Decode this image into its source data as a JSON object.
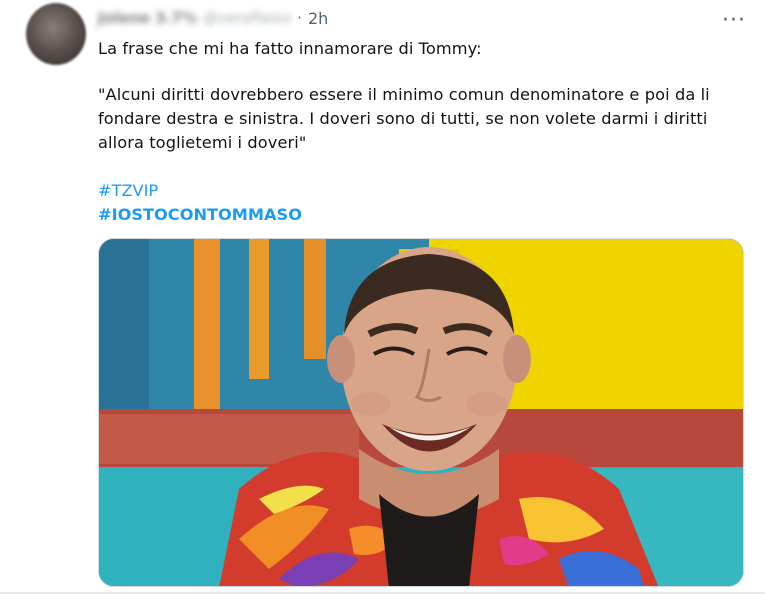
{
  "tweet": {
    "author_name": "Jolene 3.7%",
    "author_handle": "@veraflaiso",
    "separator": "·",
    "time": "2h",
    "more_label": "···",
    "line1": "La frase che mi ha fatto innamorare di Tommy:",
    "quote_line1": "\"Alcuni diritti dovrebbero essere il minimo comun denominatore e poi da li",
    "quote_line2": "fondare destra e sinistra. I doveri sono di tutti, se non volete darmi i diritti",
    "quote_line3": "allora toglietemi i doveri\"",
    "hashtag1": "#TZVIP",
    "hashtag2": "#IOSTOCONTOMMASO"
  },
  "colors": {
    "link": "#1d9bf0",
    "text": "#0f1419",
    "secondary": "#536471"
  },
  "icons": {
    "more": "more-horizontal-icon"
  }
}
